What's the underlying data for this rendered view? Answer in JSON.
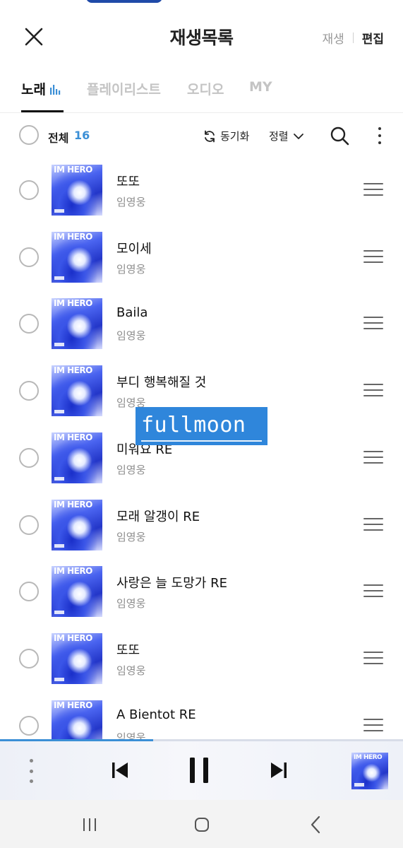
{
  "header": {
    "title": "재생목록",
    "play_label": "재생",
    "edit_label": "편집"
  },
  "tabs": [
    {
      "label": "노래",
      "active": true
    },
    {
      "label": "플레이리스트",
      "active": false
    },
    {
      "label": "오디오",
      "active": false
    },
    {
      "label": "MY",
      "active": false
    }
  ],
  "toolbar": {
    "select_all_label": "전체",
    "count": "16",
    "sync_label": "동기화",
    "sort_label": "정렬"
  },
  "album_cover_text": {
    "line1": "IM HERO",
    "brand_color": "#3a55e8"
  },
  "songs": [
    {
      "title": "또또",
      "artist": "임영웅"
    },
    {
      "title": "모이세",
      "artist": "임영웅"
    },
    {
      "title": "Baila",
      "artist": "임영웅"
    },
    {
      "title": "부디 행복해질 것",
      "artist": "임영웅"
    },
    {
      "title": "미워요 RE",
      "artist": "임영웅"
    },
    {
      "title": "모래 알갱이 RE",
      "artist": "임영웅"
    },
    {
      "title": "사랑은 늘 도망가 RE",
      "artist": "임영웅"
    },
    {
      "title": "또또",
      "artist": "임영웅"
    },
    {
      "title": "A Bientot RE",
      "artist": "임영웅"
    }
  ],
  "watermark": {
    "text": "fullmoon"
  },
  "player": {
    "progress": 0.38,
    "state": "playing"
  },
  "colors": {
    "accent": "#3b8fd6",
    "sticker_bg": "#2f86db"
  }
}
